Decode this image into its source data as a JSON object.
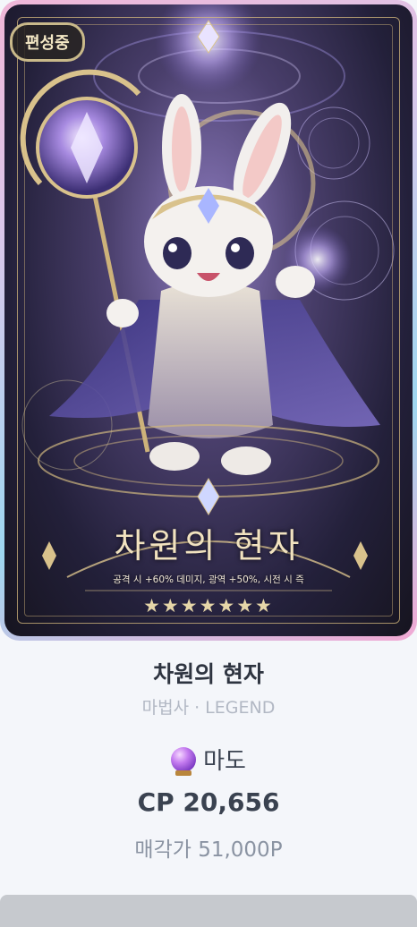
{
  "card": {
    "badge": "편성중",
    "title": "차원의 현자",
    "description": "공격 시 +60% 데미지, 광역 +50%, 시전 시 즉",
    "stars": "★★★★★★★"
  },
  "info": {
    "name": "차원의 현자",
    "class_grade": "마법사 · LEGEND",
    "element_icon": "purple-crystal-ball-icon",
    "element": "마도",
    "cp": "CP 20,656",
    "sell_price": "매각가 51,000P"
  },
  "colors": {
    "accent_gold": "#d6ba7e",
    "text_dark": "#2e3440",
    "text_muted": "#b2b8c4"
  }
}
